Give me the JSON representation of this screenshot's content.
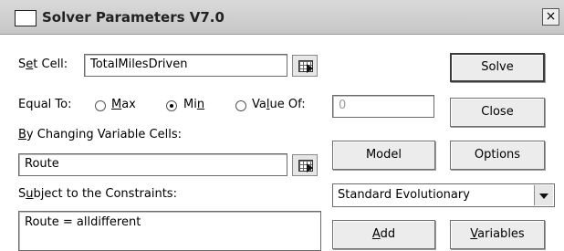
{
  "window": {
    "title": "Solver Parameters V7.0",
    "close_glyph": "×"
  },
  "set_cell": {
    "label_pre": "S",
    "label_ul": "e",
    "label_post": "t Cell:",
    "value": "TotalMilesDriven"
  },
  "equal_to": {
    "label": "Equal To:",
    "max": {
      "pre": "",
      "ul": "M",
      "post": "ax",
      "checked": false
    },
    "min": {
      "pre": "Mi",
      "ul": "n",
      "post": "",
      "checked": true
    },
    "value_of": {
      "pre": "Va",
      "ul": "l",
      "post": "ue Of:",
      "checked": false,
      "value": "0"
    }
  },
  "changing_cells": {
    "label_ul": "B",
    "label_post": "y Changing Variable Cells:",
    "value": "Route"
  },
  "constraints": {
    "label_pre": "S",
    "label_ul": "u",
    "label_post": "bject to the Constraints:",
    "items": [
      "Route = alldifferent"
    ]
  },
  "buttons": {
    "solve": "Solve",
    "close": "Close",
    "model": "Model",
    "options": "Options",
    "add_ul": "A",
    "add_post": "dd",
    "variables_ul": "V",
    "variables_post": "ariables"
  },
  "engine": {
    "selected": "Standard Evolutionary"
  }
}
